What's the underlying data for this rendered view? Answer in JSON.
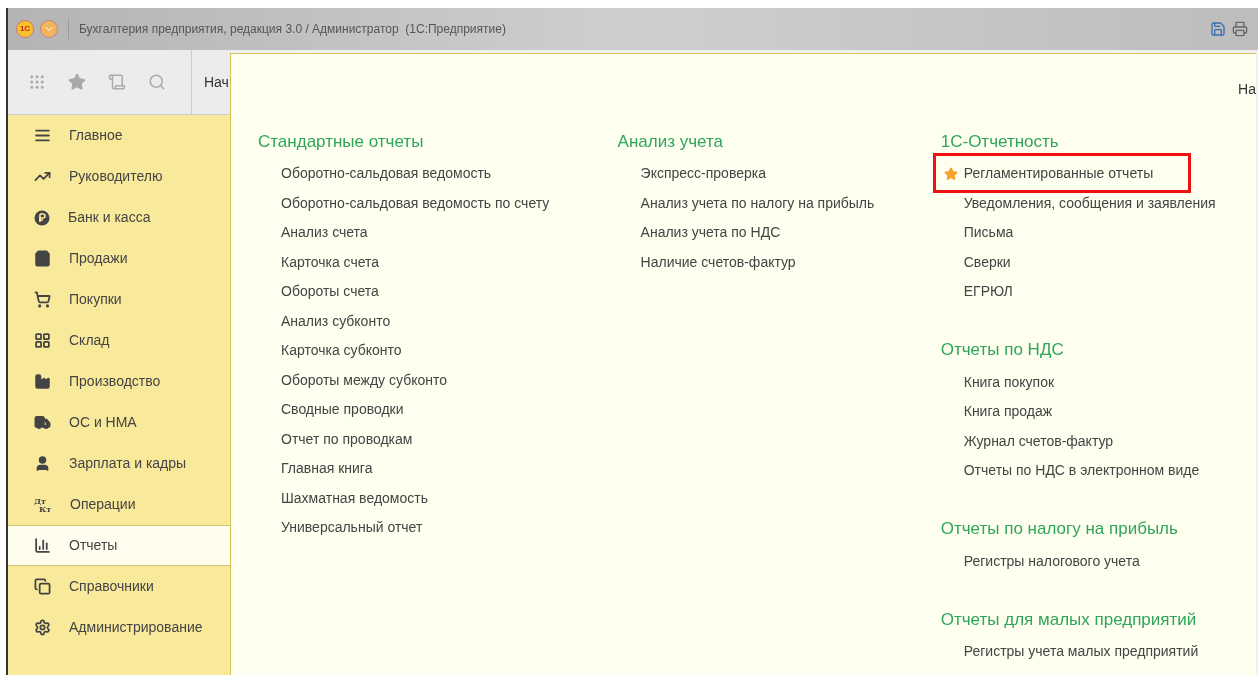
{
  "title_bar": {
    "logo": "1С",
    "title": "Бухгалтерия предприятия, редакция 3.0 / Администратор  (1С:Предприятие)"
  },
  "tabs": [
    {
      "label": "Нач"
    }
  ],
  "sidebar": {
    "items": [
      {
        "label": "Главное",
        "selected": false
      },
      {
        "label": "Руководителю",
        "selected": false
      },
      {
        "label": "Банк и касса",
        "selected": false
      },
      {
        "label": "Продажи",
        "selected": false
      },
      {
        "label": "Покупки",
        "selected": false
      },
      {
        "label": "Склад",
        "selected": false
      },
      {
        "label": "Производство",
        "selected": false
      },
      {
        "label": "ОС и НМА",
        "selected": false
      },
      {
        "label": "Зарплата и кадры",
        "selected": false
      },
      {
        "label": "Операции",
        "selected": false,
        "icon_label": [
          "Дт",
          "Кт"
        ]
      },
      {
        "label": "Отчеты",
        "selected": true
      },
      {
        "label": "Справочники",
        "selected": false
      },
      {
        "label": "Администрирование",
        "selected": false
      }
    ]
  },
  "panel": {
    "corner_text": "На",
    "columns": [
      {
        "groups": [
          {
            "heading": "Стандартные отчеты",
            "items": [
              {
                "label": "Оборотно-сальдовая ведомость",
                "favorite": false,
                "highlighted": false
              },
              {
                "label": "Оборотно-сальдовая ведомость по счету",
                "favorite": false,
                "highlighted": false
              },
              {
                "label": "Анализ счета",
                "favorite": false,
                "highlighted": false
              },
              {
                "label": "Карточка счета",
                "favorite": false,
                "highlighted": false
              },
              {
                "label": "Обороты счета",
                "favorite": false,
                "highlighted": false
              },
              {
                "label": "Анализ субконто",
                "favorite": false,
                "highlighted": false
              },
              {
                "label": "Карточка субконто",
                "favorite": false,
                "highlighted": false
              },
              {
                "label": "Обороты между субконто",
                "favorite": false,
                "highlighted": false
              },
              {
                "label": "Сводные проводки",
                "favorite": false,
                "highlighted": false
              },
              {
                "label": "Отчет по проводкам",
                "favorite": false,
                "highlighted": false
              },
              {
                "label": "Главная книга",
                "favorite": false,
                "highlighted": false
              },
              {
                "label": "Шахматная ведомость",
                "favorite": false,
                "highlighted": false
              },
              {
                "label": "Универсальный отчет",
                "favorite": false,
                "highlighted": false
              }
            ]
          }
        ]
      },
      {
        "groups": [
          {
            "heading": "Анализ учета",
            "items": [
              {
                "label": "Экспресс-проверка",
                "favorite": false,
                "highlighted": false
              },
              {
                "label": "Анализ учета по налогу на прибыль",
                "favorite": false,
                "highlighted": false
              },
              {
                "label": "Анализ учета по НДС",
                "favorite": false,
                "highlighted": false
              },
              {
                "label": "Наличие счетов-фактур",
                "favorite": false,
                "highlighted": false
              }
            ]
          }
        ]
      },
      {
        "groups": [
          {
            "heading": "1С-Отчетность",
            "items": [
              {
                "label": "Регламентированные отчеты",
                "favorite": true,
                "highlighted": true
              },
              {
                "label": "Уведомления, сообщения и заявления",
                "favorite": false,
                "highlighted": false
              },
              {
                "label": "Письма",
                "favorite": false,
                "highlighted": false
              },
              {
                "label": "Сверки",
                "favorite": false,
                "highlighted": false
              },
              {
                "label": "ЕГРЮЛ",
                "favorite": false,
                "highlighted": false
              }
            ]
          },
          {
            "heading": "Отчеты по НДС",
            "items": [
              {
                "label": "Книга покупок",
                "favorite": false,
                "highlighted": false
              },
              {
                "label": "Книга продаж",
                "favorite": false,
                "highlighted": false
              },
              {
                "label": "Журнал счетов-фактур",
                "favorite": false,
                "highlighted": false
              },
              {
                "label": "Отчеты по НДС в электронном виде",
                "favorite": false,
                "highlighted": false
              }
            ]
          },
          {
            "heading": "Отчеты по налогу на прибыль",
            "items": [
              {
                "label": "Регистры налогового учета",
                "favorite": false,
                "highlighted": false
              }
            ]
          },
          {
            "heading": "Отчеты для малых предприятий",
            "items": [
              {
                "label": "Регистры учета малых предприятий",
                "favorite": false,
                "highlighted": false
              }
            ]
          }
        ]
      }
    ]
  }
}
